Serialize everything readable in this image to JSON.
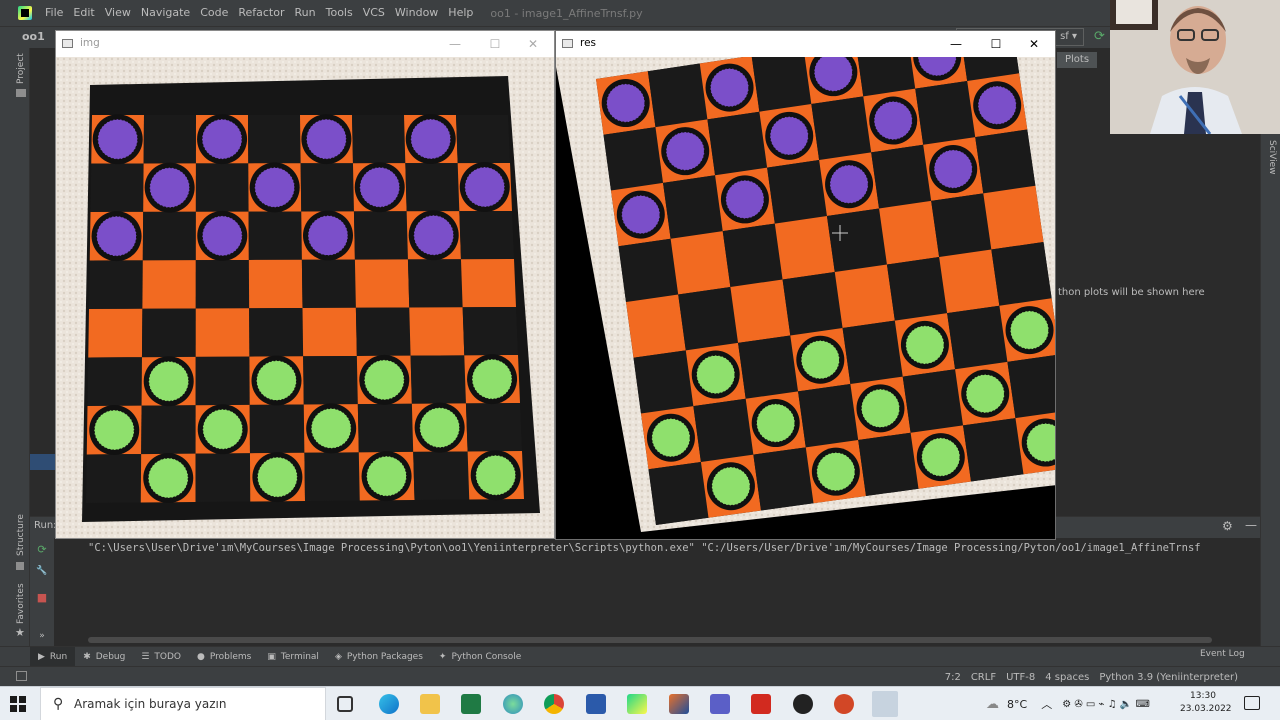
{
  "menu": {
    "items": [
      "File",
      "Edit",
      "View",
      "Navigate",
      "Code",
      "Refactor",
      "Run",
      "Tools",
      "VCS",
      "Window",
      "Help"
    ],
    "title": "oo1 - image1_AffineTrnsf.py"
  },
  "navbar": {
    "project": "oo1",
    "run_config": "sf ▾",
    "refresh_glyph": "⟳"
  },
  "left_strip": {
    "project_label": "Project",
    "structure_label": "Structure",
    "favorites_label": "Favorites"
  },
  "img_window": {
    "title": "img",
    "minimize": "—",
    "maximize": "☐",
    "close": "✕"
  },
  "res_window": {
    "title": "res",
    "minimize": "—",
    "maximize": "☐",
    "close": "✕"
  },
  "sciview": {
    "tab": "Plots",
    "note": "thon plots will be shown here",
    "vertical_label": "SciView"
  },
  "run_panel": {
    "label": "Run:",
    "settings_glyph": "⚙",
    "minimize_glyph": "—",
    "console_line": "\"C:\\Users\\User\\Drive'ım\\MyCourses\\Image Processing\\Pyton\\oo1\\Yeniinterpreter\\Scripts\\python.exe\" \"C:/Users/User/Drive'ım/MyCourses/Image Processing/Pyton/oo1/image1_AffineTrnsf",
    "tools": [
      "⟳",
      "↑",
      "🔧",
      "↓",
      "■",
      "≡",
      "⤓",
      "»"
    ]
  },
  "bottom_tools": [
    {
      "icon": "▶",
      "label": "Run"
    },
    {
      "icon": "✱",
      "label": "Debug"
    },
    {
      "icon": "☰",
      "label": "TODO"
    },
    {
      "icon": "●",
      "label": "Problems"
    },
    {
      "icon": "▣",
      "label": "Terminal"
    },
    {
      "icon": "◈",
      "label": "Python Packages"
    },
    {
      "icon": "✦",
      "label": "Python Console"
    }
  ],
  "event_log": "Event Log",
  "status": {
    "position": "7:2",
    "line_sep": "CRLF",
    "encoding": "UTF-8",
    "indent": "4 spaces",
    "interpreter": "Python 3.9 (Yeniinterpreter)"
  },
  "taskbar": {
    "search_placeholder": "Aramak için buraya yazın",
    "temperature": "8°C",
    "time": "13:30",
    "date": "23.03.2022"
  },
  "board": {
    "orange": "#f26a21",
    "black": "#1a1a1a",
    "purple": "#7b4fc9",
    "green": "#8fe06d"
  }
}
